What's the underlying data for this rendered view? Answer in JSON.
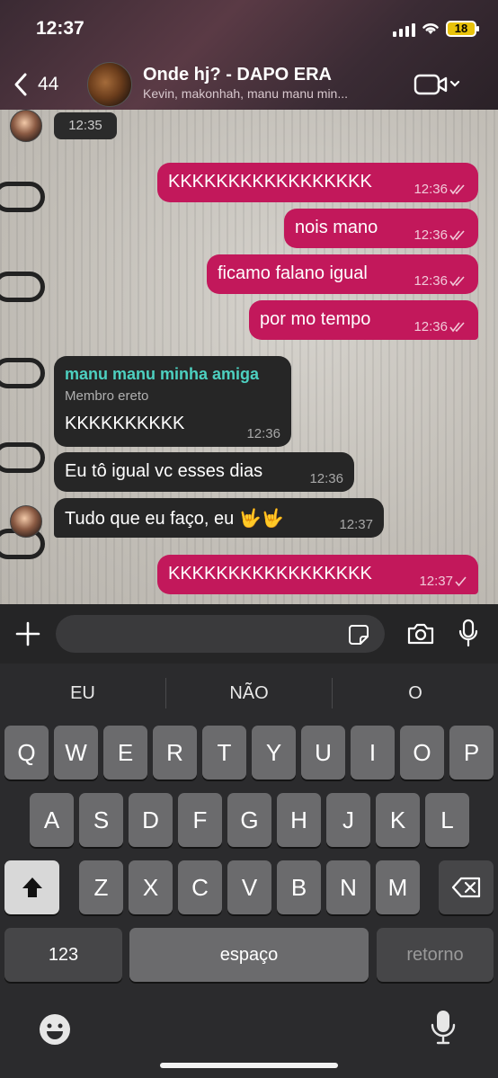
{
  "status": {
    "time": "12:37",
    "battery": "18"
  },
  "header": {
    "back_count": "44",
    "title": "Onde hj? - DAPO ERA",
    "subtitle": "Kevin, makonhah, manu manu min..."
  },
  "messages": [
    {
      "kind": "time",
      "time": "12:35"
    },
    {
      "kind": "out",
      "text": "KKKKKKKKKKKKKKKKK",
      "time": "12:36",
      "ticks": "double"
    },
    {
      "kind": "out",
      "text": "nois mano",
      "time": "12:36",
      "ticks": "double"
    },
    {
      "kind": "out",
      "text": "ficamo falano igual",
      "time": "12:36",
      "ticks": "double"
    },
    {
      "kind": "out",
      "text": "por mo tempo",
      "time": "12:36",
      "ticks": "double"
    },
    {
      "kind": "in",
      "sender": "manu manu minha amiga",
      "role": "Membro ereto",
      "text": "KKKKKKKKKK",
      "time": "12:36"
    },
    {
      "kind": "in",
      "text": "Eu tô igual vc esses dias",
      "time": "12:36"
    },
    {
      "kind": "in",
      "text": "Tudo que eu faço, eu 🤟🤟",
      "time": "12:37"
    },
    {
      "kind": "out",
      "text": "KKKKKKKKKKKKKKKKK",
      "time": "12:37",
      "ticks": "single"
    }
  ],
  "input": {
    "placeholder": ""
  },
  "keyboard": {
    "suggestions": [
      "EU",
      "NÃO",
      "O"
    ],
    "row1": [
      "Q",
      "W",
      "E",
      "R",
      "T",
      "Y",
      "U",
      "I",
      "O",
      "P"
    ],
    "row2": [
      "A",
      "S",
      "D",
      "F",
      "G",
      "H",
      "J",
      "K",
      "L"
    ],
    "row3": [
      "Z",
      "X",
      "C",
      "V",
      "B",
      "N",
      "M"
    ],
    "numbers_label": "123",
    "space_label": "espaço",
    "return_label": "retorno"
  },
  "colors": {
    "outgoing": "#c2185b",
    "incoming": "#262626",
    "sender": "#4dd0c0"
  },
  "icons": [
    "back-chevron-icon",
    "video-camera-icon",
    "plus-icon",
    "sticker-icon",
    "camera-icon",
    "microphone-icon",
    "shift-icon",
    "backspace-icon",
    "emoji-icon",
    "read-receipt-icon"
  ]
}
